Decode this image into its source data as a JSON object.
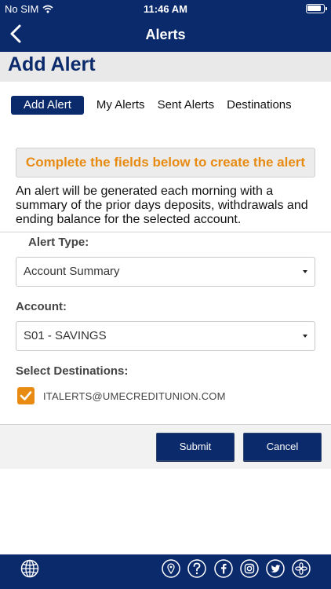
{
  "status": {
    "carrier": "No SIM",
    "time": "11:46 AM"
  },
  "nav": {
    "title": "Alerts"
  },
  "page": {
    "title": "Add Alert"
  },
  "tabs": [
    {
      "label": "Add Alert",
      "active": true
    },
    {
      "label": "My Alerts",
      "active": false
    },
    {
      "label": "Sent Alerts",
      "active": false
    },
    {
      "label": "Destinations",
      "active": false
    }
  ],
  "notice": "Complete the fields below to create the alert",
  "description": "An alert will be generated each morning with a summary of the prior days deposits, withdrawals and ending balance for the selected account.",
  "form": {
    "alert_type_label": "Alert Type:",
    "alert_type_value": "Account Summary",
    "account_label": "Account:",
    "account_value": "S01 - SAVINGS",
    "destinations_label": "Select Destinations:",
    "destination_email": "ITALERTS@UMECREDITUNION.COM",
    "destination_checked": true
  },
  "buttons": {
    "submit": "Submit",
    "cancel": "Cancel"
  },
  "colors": {
    "brand_navy": "#0b2a6b",
    "accent_orange": "#e88b12"
  },
  "bottom_icons": [
    "globe-icon",
    "map-pin-icon",
    "help-icon",
    "facebook-icon",
    "instagram-icon",
    "twitter-icon",
    "settings-flower-icon"
  ]
}
